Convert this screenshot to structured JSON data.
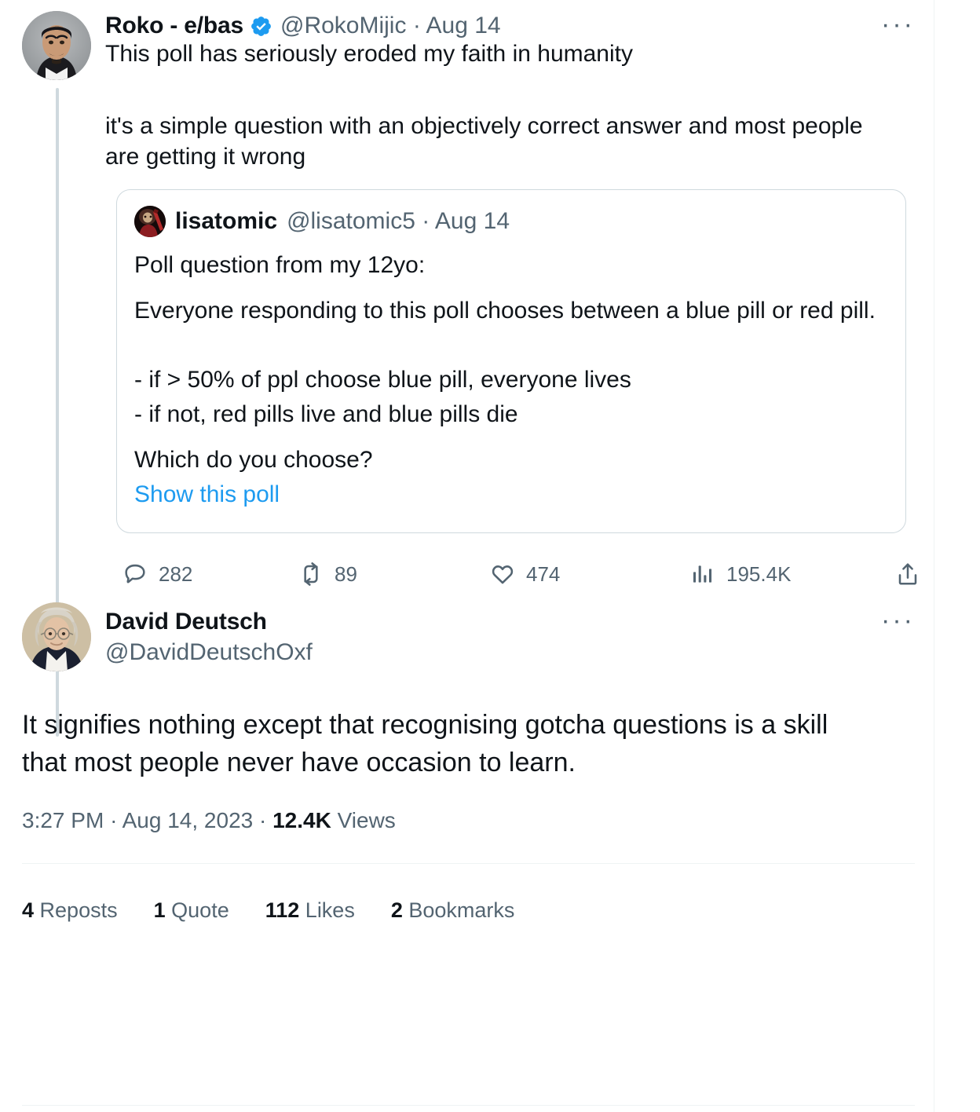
{
  "parent_tweet": {
    "display_name": "Roko - e/bas",
    "verified": true,
    "verified_color": "#1d9bf0",
    "handle": "@RokoMijic",
    "separator": "·",
    "date": "Aug 14",
    "more_icon": "···",
    "text_line_1": "This poll has seriously eroded my faith in humanity",
    "text_body": "it's a simple question with an objectively correct answer and most people are getting it wrong"
  },
  "quoted_tweet": {
    "display_name": "lisatomic",
    "handle": "@lisatomic5",
    "separator": "·",
    "date": "Aug 14",
    "text_p1": "Poll question from my 12yo:",
    "text_p2": "Everyone responding to this poll chooses between a blue pill or red pill.",
    "text_p3_line1": "- if > 50% of ppl choose blue pill, everyone lives",
    "text_p3_line2": "- if not, red pills live and blue pills die",
    "text_p4": "Which do you choose?",
    "show_poll_label": "Show this poll",
    "link_color": "#1d9bf0"
  },
  "action_bar": {
    "reply": {
      "icon": "reply-icon",
      "count": "282"
    },
    "retweet": {
      "icon": "retweet-icon",
      "count": "89"
    },
    "like": {
      "icon": "heart-icon",
      "count": "474"
    },
    "views": {
      "icon": "analytics-icon",
      "count": "195.4K"
    },
    "share": {
      "icon": "share-icon"
    }
  },
  "main_tweet": {
    "display_name": "David Deutsch",
    "handle": "@DavidDeutschOxf",
    "more_icon": "···",
    "text": "It signifies nothing except that recognising gotcha questions is a skill that most people never have occasion to learn.",
    "time": "3:27 PM",
    "sep1": "·",
    "date": "Aug 14, 2023",
    "sep2": "·",
    "views_count": "12.4K",
    "views_label": "Views"
  },
  "stats": [
    {
      "count": "4",
      "label": "Reposts"
    },
    {
      "count": "1",
      "label": "Quote"
    },
    {
      "count": "112",
      "label": "Likes"
    },
    {
      "count": "2",
      "label": "Bookmarks"
    }
  ],
  "colors": {
    "text_primary": "#0f1419",
    "text_secondary": "#536471",
    "accent": "#1d9bf0",
    "border": "#cfd9de",
    "divider": "#eff3f4"
  }
}
